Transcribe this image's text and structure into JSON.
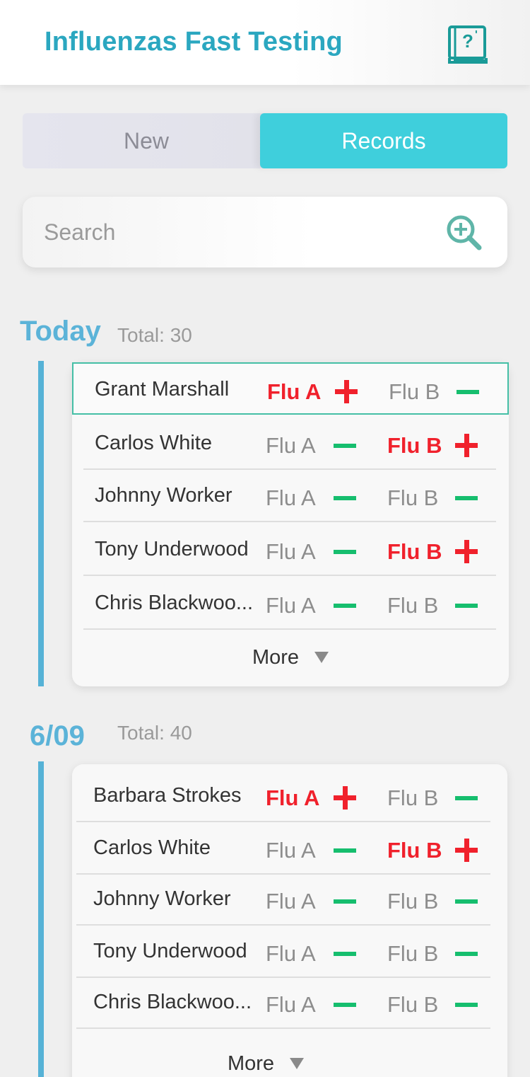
{
  "header": {
    "title": "Influenzas Fast Testing",
    "help_icon": "help-book-icon"
  },
  "tabs": [
    {
      "label": "New",
      "active": false
    },
    {
      "label": "Records",
      "active": true
    }
  ],
  "search": {
    "placeholder": "Search",
    "value": ""
  },
  "colors": {
    "accent": "#2ba7c0",
    "tab_active": "#3fcfdc",
    "positive": "#f0212c",
    "negative": "#16be6e",
    "timeline": "#56b2d6",
    "selected_border": "#45bfa6"
  },
  "groups": [
    {
      "date": "Today",
      "total": "Total: 30",
      "rows": [
        {
          "name": "Grant Marshall",
          "flu_a": "Flu A",
          "flu_a_result": "positive",
          "flu_b": "Flu B",
          "flu_b_result": "negative",
          "selected": true
        },
        {
          "name": "Carlos White",
          "flu_a": "Flu A",
          "flu_a_result": "negative",
          "flu_b": "Flu B",
          "flu_b_result": "positive"
        },
        {
          "name": "Johnny Worker",
          "flu_a": "Flu A",
          "flu_a_result": "negative",
          "flu_b": "Flu B",
          "flu_b_result": "negative"
        },
        {
          "name": "Tony Underwood",
          "flu_a": "Flu A",
          "flu_a_result": "negative",
          "flu_b": "Flu B",
          "flu_b_result": "positive"
        },
        {
          "name": "Chris Blackwoo...",
          "flu_a": "Flu A",
          "flu_a_result": "negative",
          "flu_b": "Flu B",
          "flu_b_result": "negative"
        }
      ],
      "more": "More"
    },
    {
      "date": "6/09",
      "total": "Total: 40",
      "rows": [
        {
          "name": "Barbara Strokes",
          "flu_a": "Flu A",
          "flu_a_result": "positive",
          "flu_b": "Flu B",
          "flu_b_result": "negative"
        },
        {
          "name": "Carlos White",
          "flu_a": "Flu A",
          "flu_a_result": "negative",
          "flu_b": "Flu B",
          "flu_b_result": "positive"
        },
        {
          "name": "Johnny Worker",
          "flu_a": "Flu A",
          "flu_a_result": "negative",
          "flu_b": "Flu B",
          "flu_b_result": "negative"
        },
        {
          "name": "Tony Underwood",
          "flu_a": "Flu A",
          "flu_a_result": "negative",
          "flu_b": "Flu B",
          "flu_b_result": "negative"
        },
        {
          "name": "Chris Blackwoo...",
          "flu_a": "Flu A",
          "flu_a_result": "negative",
          "flu_b": "Flu B",
          "flu_b_result": "negative"
        }
      ],
      "more": "More"
    }
  ]
}
